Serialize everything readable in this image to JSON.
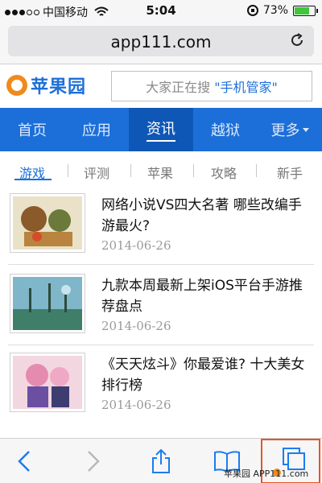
{
  "status_bar": {
    "carrier": "中国移动",
    "time": "5:04",
    "battery": "73%",
    "battery_level": 0.73
  },
  "browser": {
    "url": "app111.com"
  },
  "site": {
    "logo_text": "苹果园",
    "search_prefix": "大家正在搜",
    "search_term": "\"手机管家\""
  },
  "nav": {
    "items": [
      {
        "label": "首页"
      },
      {
        "label": "应用"
      },
      {
        "label": "资讯"
      },
      {
        "label": "越狱"
      },
      {
        "label": "更多"
      }
    ],
    "active_index": 2
  },
  "subtabs": {
    "items": [
      {
        "label": "游戏"
      },
      {
        "label": "评测"
      },
      {
        "label": "苹果"
      },
      {
        "label": "攻略"
      },
      {
        "label": "新手"
      }
    ],
    "active_index": 0
  },
  "articles": [
    {
      "title": "网络小说VS四大名著 哪些改编手游最火?",
      "date": "2014-06-26"
    },
    {
      "title": "九款本周最新上架iOS平台手游推荐盘点",
      "date": "2014-06-26"
    },
    {
      "title": "《天天炫斗》你最爱谁? 十大美女排行榜",
      "date": "2014-06-26"
    }
  ],
  "toolbar": {
    "icons": [
      "back-icon",
      "forward-icon",
      "share-icon",
      "bookmarks-icon",
      "tabs-icon"
    ]
  },
  "watermark": "苹果园 APP111.com",
  "colors": {
    "brand_blue": "#1c6fd8",
    "logo_orange": "#f08a1c",
    "highlight_box": "#e5562a"
  }
}
